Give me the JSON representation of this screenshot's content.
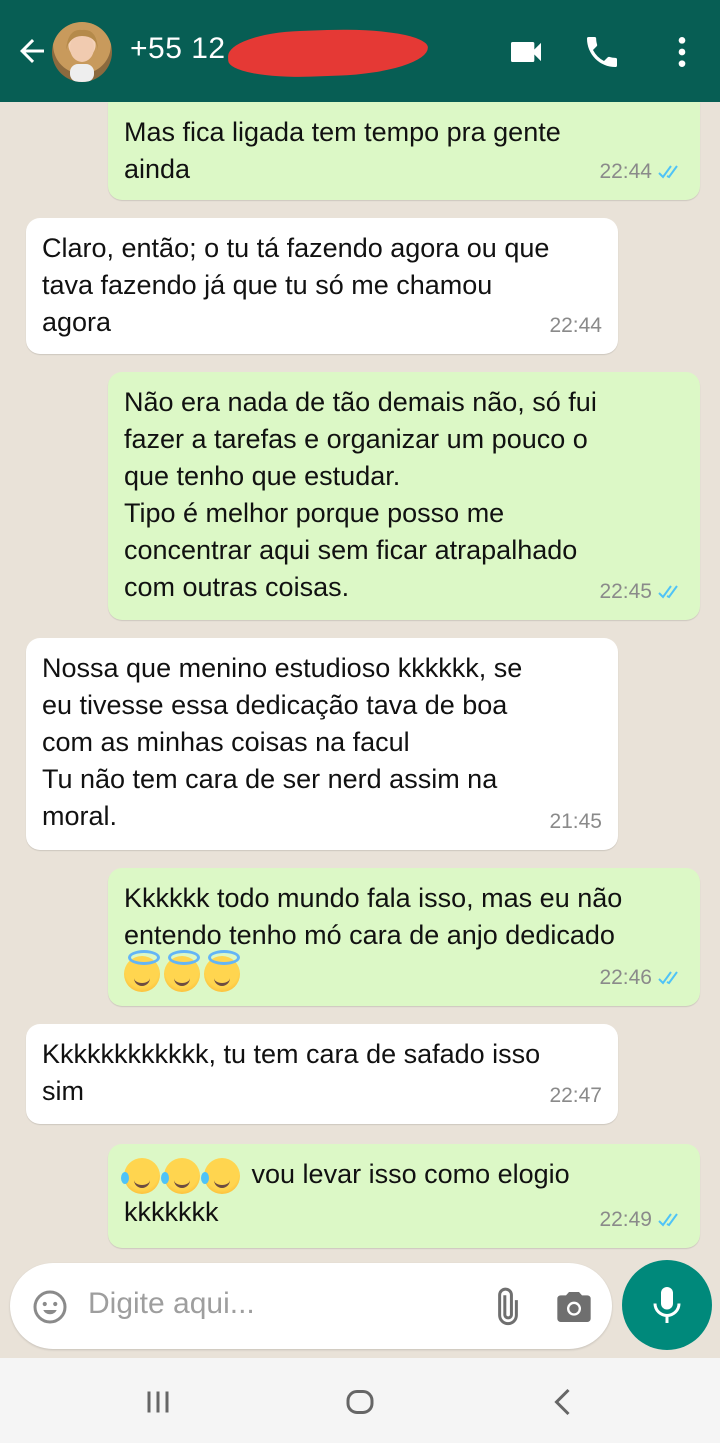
{
  "header": {
    "contact": "+55 12",
    "redacted_suffix": "-"
  },
  "messages": [
    {
      "dir": "out",
      "text": "Mas fica ligada tem tempo pra gente\nainda",
      "time": "22:44",
      "read": true
    },
    {
      "dir": "in",
      "text": "Claro, então; o tu tá fazendo agora ou que\ntava fazendo já que tu só me chamou\nagora",
      "time": "22:44"
    },
    {
      "dir": "out",
      "text": "Não era nada de tão demais não, só fui\nfazer a tarefas e organizar um pouco o\nque tenho que estudar.\nTipo é melhor porque posso me\nconcentrar aqui sem ficar atrapalhado\ncom outras coisas.",
      "time": "22:45",
      "read": true
    },
    {
      "dir": "in",
      "text": "Nossa que menino estudioso kkkkkk, se\neu tivesse essa dedicação tava de boa\ncom as minhas coisas na facul\nTu não tem cara de ser nerd assim na\nmoral.",
      "time": "21:45"
    },
    {
      "dir": "out",
      "text": "Kkkkkk todo mundo fala isso, mas eu não\nentendo tenho mó cara de anjo dedicado",
      "emoji_line": "angel-face-emoji x3",
      "time": "22:46",
      "read": true
    },
    {
      "dir": "in",
      "text": "Kkkkkkkkkkkk, tu tem cara de safado isso\nsim",
      "time": "22:47"
    },
    {
      "dir": "out",
      "text_after_emoji": "vou levar isso como elogio",
      "text2": "kkkkkkk",
      "emoji_prefix": "tears-of-joy-emoji x3",
      "time": "22:49",
      "read": true
    }
  ],
  "input": {
    "placeholder": "Digite aqui..."
  },
  "colors": {
    "header": "#075e54",
    "outgoing_bubble": "#dcf8c6",
    "incoming_bubble": "#ffffff",
    "read_ticks": "#4fc3f7",
    "mic_button": "#00897b",
    "redaction": "#e53935"
  },
  "icons": [
    "back-arrow-icon",
    "video-call-icon",
    "phone-icon",
    "more-vert-icon",
    "emoji-icon",
    "attach-icon",
    "camera-icon",
    "mic-icon",
    "recent-apps-icon",
    "home-icon",
    "back-nav-icon"
  ]
}
